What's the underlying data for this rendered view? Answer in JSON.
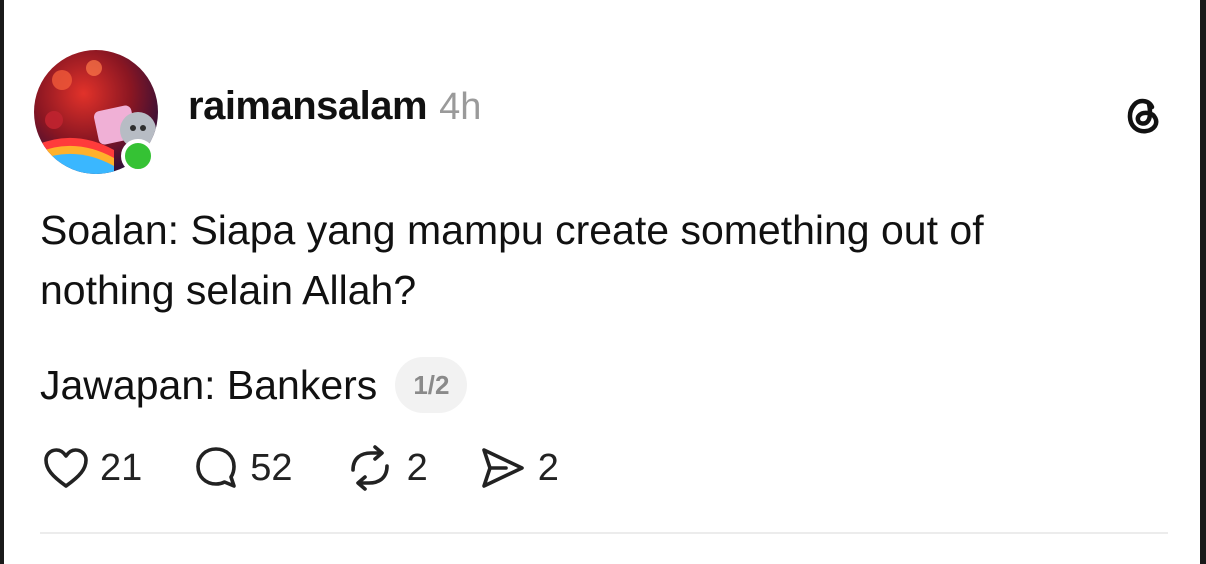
{
  "post": {
    "username": "raimansalam",
    "timestamp": "4h",
    "text_lines": [
      "Soalan: Siapa yang mampu create something out of",
      "nothing selain Allah?"
    ],
    "answer": "Jawapan: Bankers",
    "thread_position": "1/2"
  },
  "actions": {
    "like": {
      "icon": "heart-icon",
      "count": "21"
    },
    "comment": {
      "icon": "comment-icon",
      "count": "52"
    },
    "repost": {
      "icon": "repost-icon",
      "count": "2"
    },
    "share": {
      "icon": "send-icon",
      "count": "2"
    }
  },
  "icons": {
    "app_logo": "threads-logo-icon",
    "online_status": "online-status-dot"
  },
  "colors": {
    "online": "#35c234",
    "timestamp": "#9a9a9a",
    "badge_bg": "#f2f2f2",
    "badge_text": "#8a8a8a"
  }
}
